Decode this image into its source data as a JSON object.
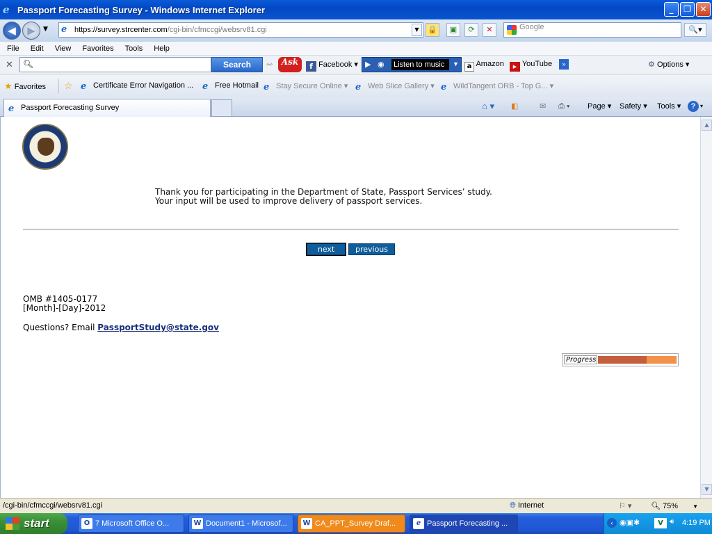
{
  "window": {
    "title": "Passport Forecasting Survey - Windows Internet Explorer",
    "controls": [
      "_",
      "❐",
      "✕"
    ]
  },
  "address": {
    "url_scheme": "https://",
    "url_host": "survey.strcenter.com",
    "url_path": "/cgi-bin/cfmccgi/websrv81.cgi",
    "search_placeholder": "Google"
  },
  "menu": [
    "File",
    "Edit",
    "View",
    "Favorites",
    "Tools",
    "Help"
  ],
  "ask_toolbar": {
    "search_label": "Search",
    "ask_logo": "Ask",
    "facebook": "Facebook",
    "music": "Listen to music",
    "amazon": "Amazon",
    "youtube": "YouTube",
    "options": "Options"
  },
  "favorites_bar": {
    "favorites": "Favorites",
    "items": [
      "Certificate Error Navigation ...",
      "Free Hotmail",
      "Stay Secure Online",
      "Web Slice Gallery",
      "WildTangent ORB - Top G..."
    ]
  },
  "tab": {
    "label": "Passport Forecasting Survey"
  },
  "command_bar": [
    "Page",
    "Safety",
    "Tools"
  ],
  "page": {
    "thanks_line1": "Thank you for participating in the Department of State, Passport Services’ study.",
    "thanks_line2": "Your input will be used to improve delivery of passport services.",
    "next": "next",
    "previous": "previous",
    "omb": "OMB #1405-0177",
    "date": "[Month]-[Day]-2012",
    "questions": "Questions? Email",
    "email": "PassportStudy@state.gov",
    "progress_label": "Progress",
    "progress_fraction": 0.62
  },
  "status": {
    "path": "/cgi-bin/cfmccgi/websrv81.cgi",
    "zone": "Internet",
    "zoom": "75%"
  },
  "taskbar": {
    "start": "start",
    "tasks": [
      "7 Microsoft Office O...",
      "Document1 - Microsof...",
      "CA_PPT_Survey Draf...",
      "Passport Forecasting ..."
    ],
    "clock": "4:19 PM"
  },
  "colors": {
    "button_blue": "#0f5d9a",
    "progress_done": "#c35f3c",
    "progress_track": "#f3914c",
    "link": "#1a2f7a"
  }
}
